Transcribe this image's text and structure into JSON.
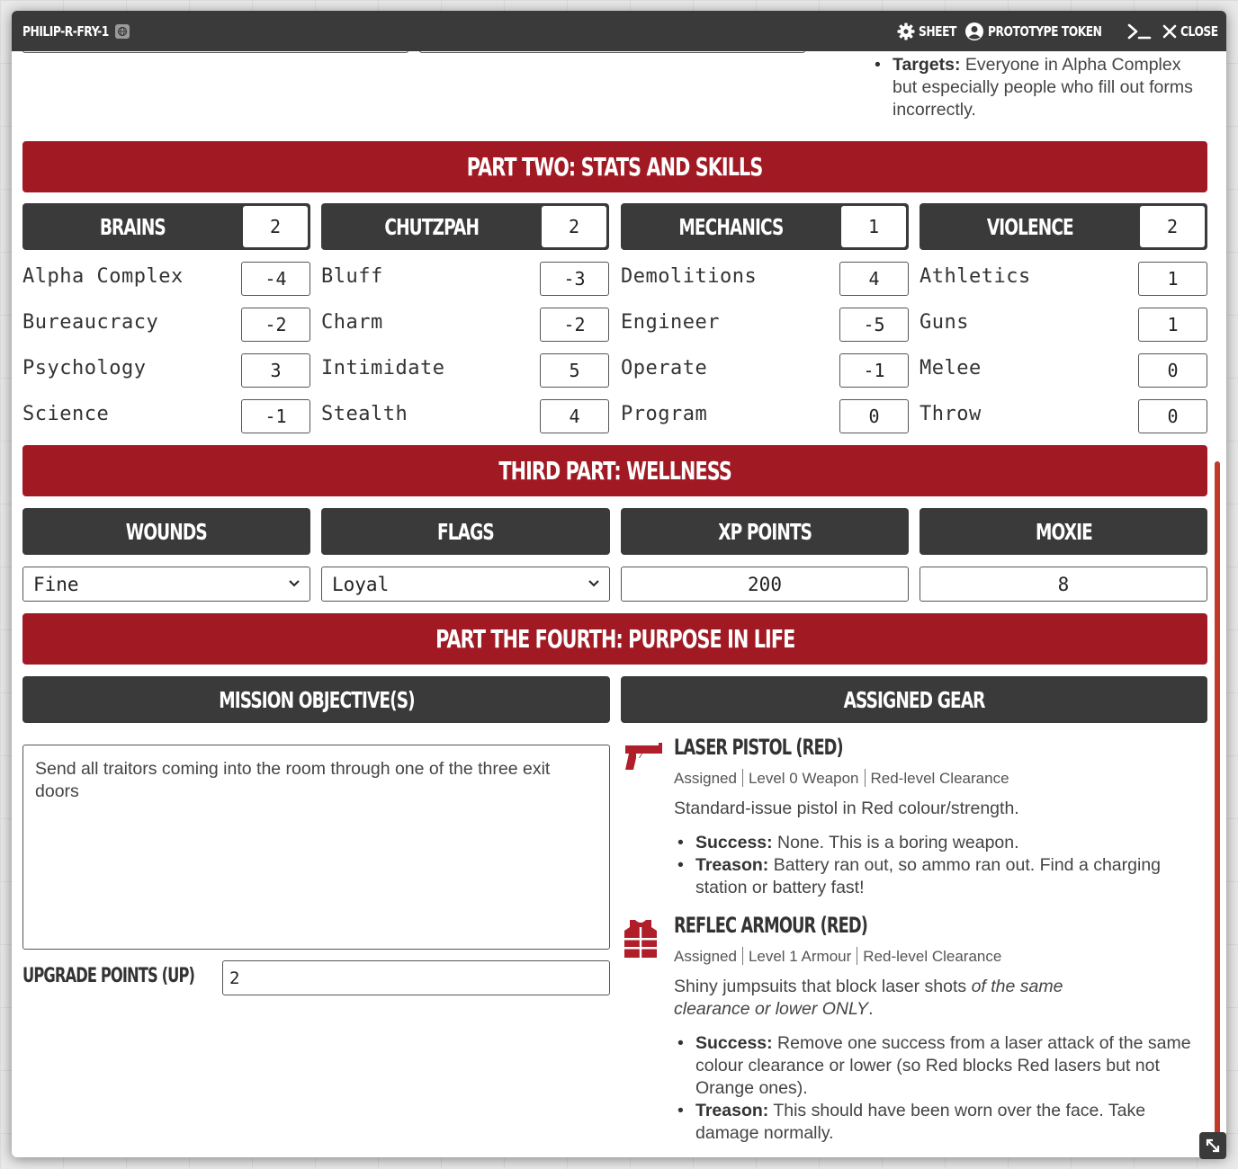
{
  "titlebar": {
    "name": "PHILIP-R-FRY-1",
    "sheet_label": "SHEET",
    "token_label": "PROTOTYPE TOKEN",
    "close_label": "CLOSE"
  },
  "targets": {
    "label": "Targets:",
    "text": " Everyone in Alpha Complex but especially people who fill out forms incorrectly."
  },
  "sections": {
    "stats": "PART TWO: STATS AND SKILLS",
    "wellness": "THIRD PART: WELLNESS",
    "purpose": "PART THE FOURTH: PURPOSE IN LIFE"
  },
  "stats": [
    {
      "name": "BRAINS",
      "value": "2",
      "skills": [
        {
          "name": "Alpha Complex",
          "value": "-4"
        },
        {
          "name": "Bureaucracy",
          "value": "-2"
        },
        {
          "name": "Psychology",
          "value": "3"
        },
        {
          "name": "Science",
          "value": "-1"
        }
      ]
    },
    {
      "name": "CHUTZPAH",
      "value": "2",
      "skills": [
        {
          "name": "Bluff",
          "value": "-3"
        },
        {
          "name": "Charm",
          "value": "-2"
        },
        {
          "name": "Intimidate",
          "value": "5"
        },
        {
          "name": "Stealth",
          "value": "4"
        }
      ]
    },
    {
      "name": "MECHANICS",
      "value": "1",
      "skills": [
        {
          "name": "Demolitions",
          "value": "4"
        },
        {
          "name": "Engineer",
          "value": "-5"
        },
        {
          "name": "Operate",
          "value": "-1"
        },
        {
          "name": "Program",
          "value": "0"
        }
      ]
    },
    {
      "name": "VIOLENCE",
      "value": "2",
      "skills": [
        {
          "name": "Athletics",
          "value": "1"
        },
        {
          "name": "Guns",
          "value": "1"
        },
        {
          "name": "Melee",
          "value": "0"
        },
        {
          "name": "Throw",
          "value": "0"
        }
      ]
    }
  ],
  "wellness": {
    "wounds_label": "WOUNDS",
    "flags_label": "FLAGS",
    "xp_label": "XP POINTS",
    "moxie_label": "MOXIE",
    "wounds_value": "Fine",
    "flags_value": "Loyal",
    "xp_value": "200",
    "moxie_value": "8"
  },
  "purpose": {
    "mission_label": "MISSION OBJECTIVE(S)",
    "gear_label": "ASSIGNED GEAR",
    "mission_text": "Send all traitors coming into the room through one of the three exit doors",
    "up_label": "UPGRADE POINTS (UP)",
    "up_value": "2"
  },
  "gear": [
    {
      "icon": "pistol-icon",
      "title": "LASER PISTOL (RED)",
      "meta": [
        "Assigned",
        "Level 0 Weapon",
        "Red-level Clearance"
      ],
      "desc": "Standard-issue pistol in Red colour/strength.",
      "success_label": "Success:",
      "success_text": " None. This is a boring weapon.",
      "treason_label": "Treason:",
      "treason_text": " Battery ran out, so ammo ran out. Find a charging station or battery fast!"
    },
    {
      "icon": "armour-vest-icon",
      "title": "REFLEC ARMOUR (RED)",
      "meta": [
        "Assigned",
        "Level 1 Armour",
        "Red-level Clearance"
      ],
      "desc_plain": "Shiny jumpsuits that block laser shots ",
      "desc_italic": "of the same clearance or lower ONLY",
      "desc_end": ".",
      "success_label": "Success:",
      "success_text": " Remove one success from a laser attack of the same colour clearance or lower (so Red blocks Red lasers but not Orange ones).",
      "treason_label": "Treason:",
      "treason_text": " This should have been worn over the face. Take damage normally."
    }
  ],
  "colors": {
    "section_red": "#a11a23",
    "header_dark": "#3a3a3a",
    "icon_red": "#b01e2a",
    "scrollbar": "#c0392b"
  }
}
